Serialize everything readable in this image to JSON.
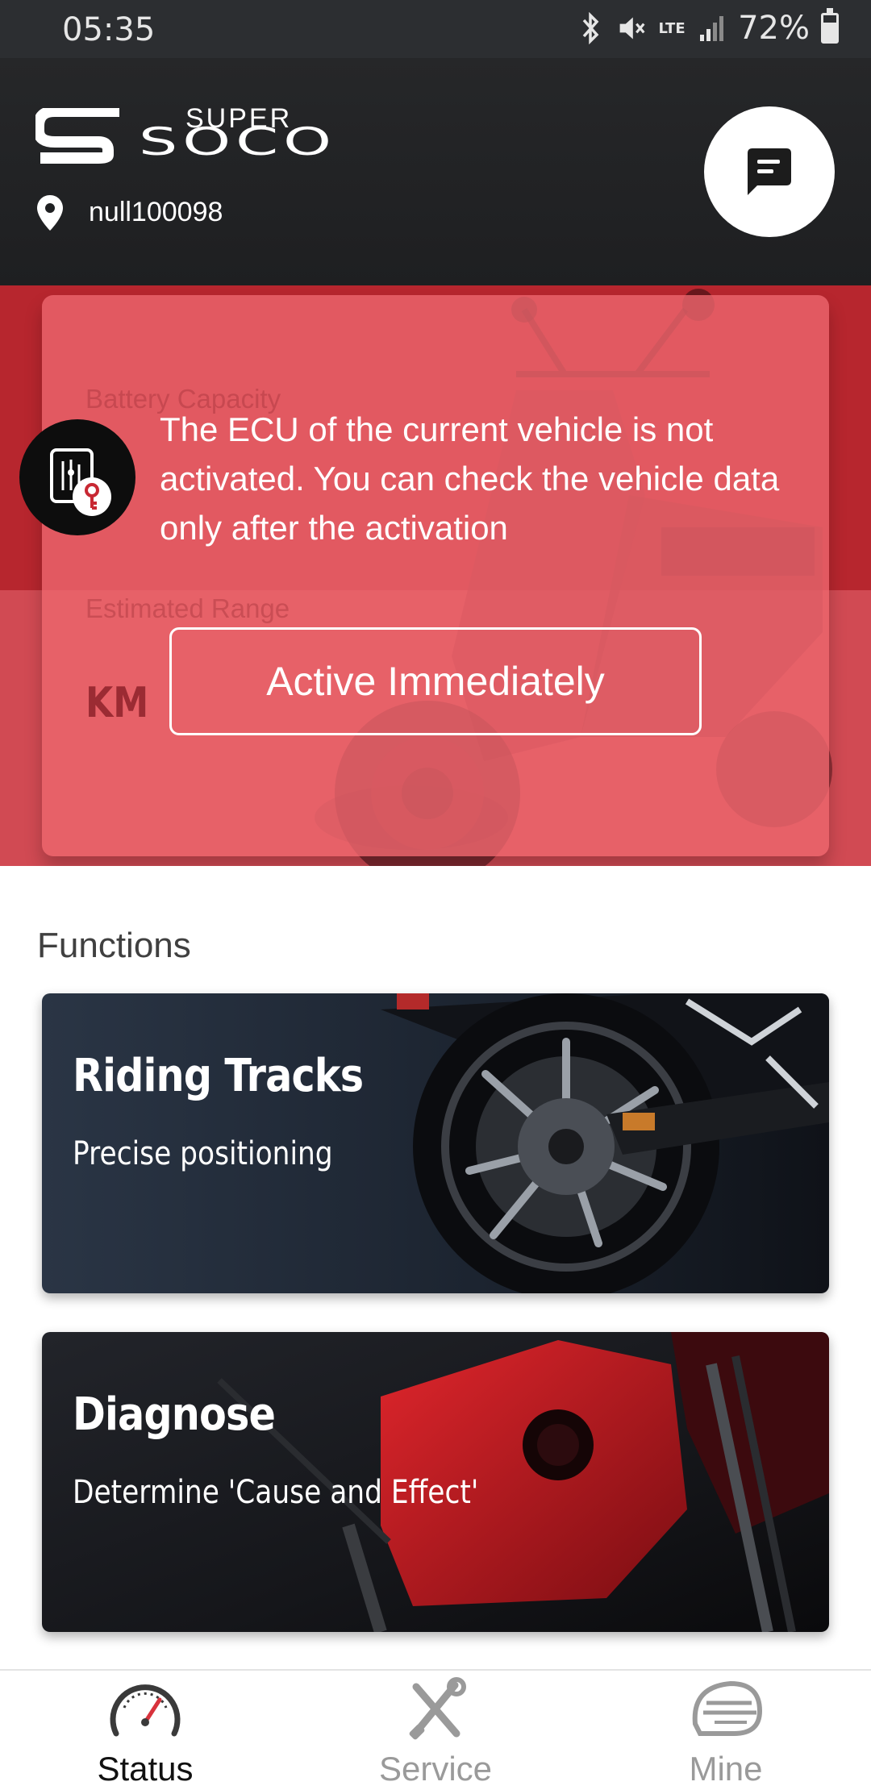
{
  "status_bar": {
    "time": "05:35",
    "network": "LTE",
    "battery_percent": "72%",
    "battery_level": 0.72,
    "icons": [
      "bluetooth-icon",
      "mute-icon",
      "lte-icon",
      "signal-icon",
      "battery-icon"
    ]
  },
  "header": {
    "logo_super": "SUPER",
    "logo_soco": "SOCO",
    "location": "null100098",
    "message_icon": "message-icon"
  },
  "vehicle_card": {
    "battery_label": "Battery Capacity",
    "range_label": "Estimated Range",
    "range_unit": "KM",
    "ecu_message": "The ECU of the current vehicle is not activated. You can check the vehicle data only after the activation",
    "activate_button": "Active Immediately",
    "ecu_icon": "ecu-key-icon"
  },
  "functions": {
    "title": "Functions",
    "cards": [
      {
        "title": "Riding Tracks",
        "subtitle": "Precise positioning"
      },
      {
        "title": "Diagnose",
        "subtitle": "Determine 'Cause and Effect'"
      }
    ]
  },
  "tabs": [
    {
      "label": "Status",
      "icon": "speedometer-icon",
      "active": true
    },
    {
      "label": "Service",
      "icon": "tools-icon",
      "active": false
    },
    {
      "label": "Mine",
      "icon": "helmet-icon",
      "active": false
    }
  ],
  "colors": {
    "header_bg": "#1f2022",
    "accent_red": "#b7262e",
    "overlay_red": "#ec666e",
    "tab_active": "#111111",
    "tab_inactive": "#9a9a9a"
  }
}
